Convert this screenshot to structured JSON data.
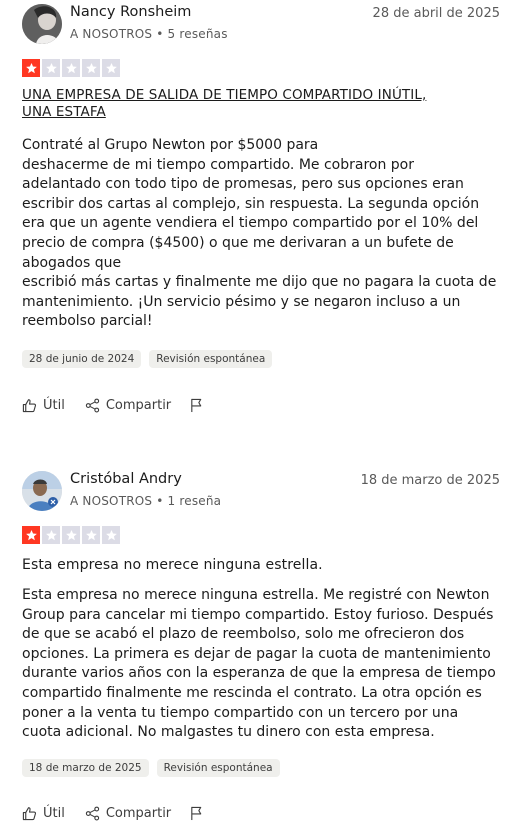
{
  "reviews": [
    {
      "author": "Nancy Ronsheim",
      "meta": "A NOSOTROS • 5 reseñas",
      "date": "28 de abril de 2025",
      "rating": 1,
      "max_rating": 5,
      "title_lines": [
        "UNA EMPRESA DE SALIDA DE TIEMPO COMPARTIDO INÚTIL,",
        "UNA ESTAFA"
      ],
      "body_lines": [
        "Contraté al Grupo Newton por $5000 para",
        "deshacerme de mi tiempo compartido. Me cobraron por",
        "adelantado con todo tipo de promesas, pero sus opciones eran",
        "escribir dos cartas al complejo, sin respuesta. La segunda opción",
        "era que un agente vendiera el tiempo compartido por el 10% del",
        "precio de compra ($4500) o que me derivaran a un bufete de",
        "abogados que",
        "escribió más cartas y finalmente me dijo que no pagara la cuota de",
        "mantenimiento. ¡Un servicio pésimo y se negaron incluso a un",
        "reembolso parcial!"
      ],
      "experience_date": "28 de junio de 2024",
      "tag": "Revisión espontánea",
      "actions": {
        "useful": "Útil",
        "share": "Compartir"
      }
    },
    {
      "author": "Cristóbal Andry",
      "meta": "A NOSOTROS • 1 reseña",
      "date": "18 de marzo de 2025",
      "rating": 1,
      "max_rating": 5,
      "title_lines": [
        "Esta empresa no merece ninguna estrella."
      ],
      "body_lines": [
        "Esta empresa no merece ninguna estrella. Me registré con Newton",
        "Group para cancelar mi tiempo compartido. Estoy furioso. Después",
        "de que se acabó el plazo de reembolso, solo me ofrecieron dos",
        "opciones. La primera es dejar de pagar la cuota de mantenimiento",
        "durante varios años con la esperanza de que la empresa de tiempo",
        "compartido finalmente me rescinda el contrato. La otra opción es",
        "poner a la venta tu tiempo compartido con un tercero por una",
        "cuota adicional. No malgastes tu dinero con esta empresa."
      ],
      "experience_date": "18 de marzo de 2025",
      "tag": "Revisión espontánea",
      "actions": {
        "useful": "Útil",
        "share": "Compartir"
      }
    }
  ],
  "colors": {
    "star_on": "#ff3722",
    "star_off": "#dcdce6",
    "tag_bg": "#efefec"
  },
  "icons": [
    "star-icon",
    "thumbs-up-icon",
    "share-icon",
    "flag-icon"
  ]
}
